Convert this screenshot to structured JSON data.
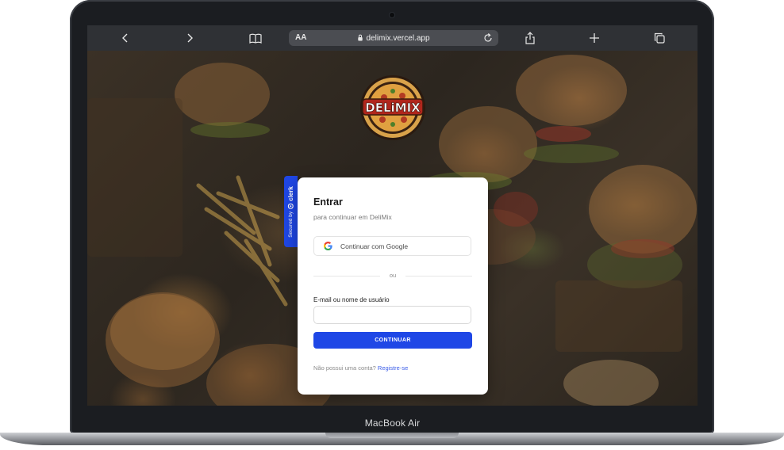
{
  "device": {
    "model_label": "MacBook Air"
  },
  "browser": {
    "text_size_label": "AA",
    "url": "delimix.vercel.app",
    "icons": {
      "back": "chevron-left-icon",
      "forward": "chevron-right-icon",
      "bookmarks": "book-icon",
      "lock": "lock-icon",
      "reload": "reload-icon",
      "share": "share-icon",
      "new_tab": "plus-icon",
      "tabs": "tabs-icon"
    }
  },
  "logo": {
    "text": "DELiMIX"
  },
  "clerk_badge": {
    "prefix": "Secured by",
    "brand": "clerk"
  },
  "signin": {
    "title": "Entrar",
    "subtitle": "para continuar em DeliMix",
    "google_button": "Continuar com Google",
    "divider": "ou",
    "identifier_label": "E-mail ou nome de usuário",
    "identifier_value": "",
    "continue_button": "CONTINUAR",
    "footer_text": "Não possui uma conta?",
    "footer_link": "Registre-se"
  },
  "colors": {
    "accent": "#1f47e6",
    "link": "#3a5ce8",
    "toolbar": "#2f3135",
    "frame": "#1b1d21"
  }
}
